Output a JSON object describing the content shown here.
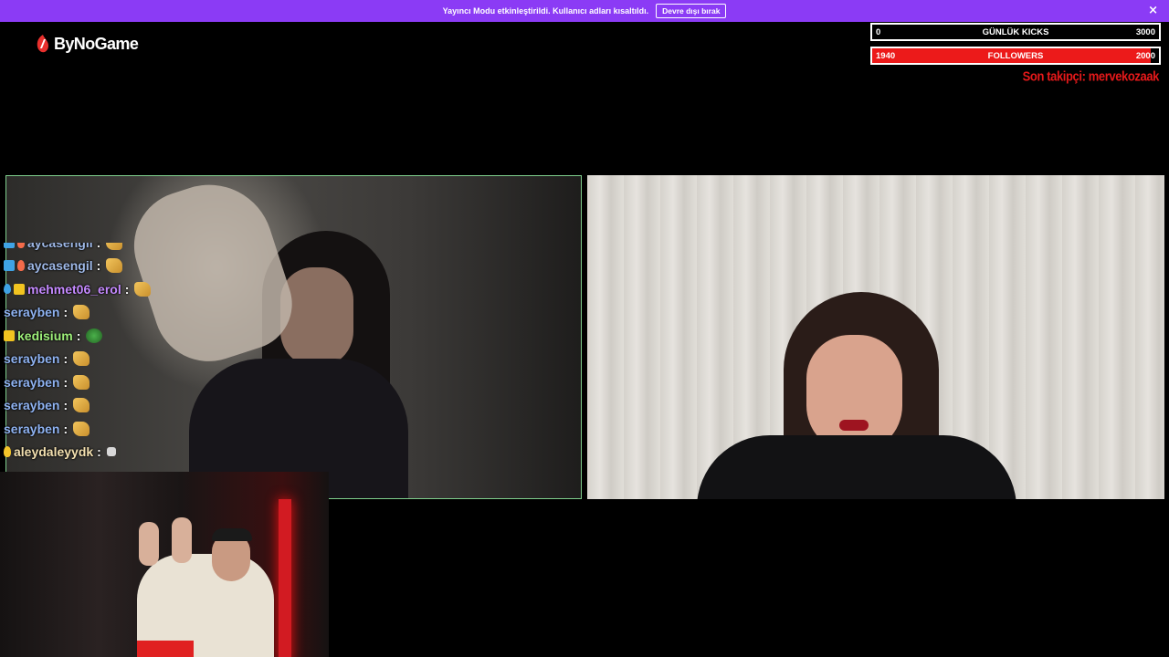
{
  "banner": {
    "text": "Yayıncı Modu etkinleştirildi. Kullanıcı adları kısaltıldı.",
    "button_label": "Devre dışı bırak",
    "close_glyph": "×"
  },
  "logo": {
    "text": "ByNoGame",
    "icon": "bynogame-logo-icon"
  },
  "goals": {
    "kicks": {
      "current": "0",
      "label": "GÜNLÜK KICKS",
      "target": "3000",
      "progress": 0
    },
    "followers": {
      "current": "1940",
      "label": "FOLLOWERS",
      "target": "2000",
      "progress": 0.97
    },
    "last_follower": "Son takipçi: mervekozaak",
    "accent_color": "#e5191a"
  },
  "chat": {
    "messages": [
      {
        "badges": [
          "blue",
          "fire"
        ],
        "user": "aycasengil",
        "user_color": "#9fb9e8",
        "emote": "clap"
      },
      {
        "badges": [
          "blue",
          "fire"
        ],
        "user": "aycasengil",
        "user_color": "#9fb9e8",
        "emote": "clap"
      },
      {
        "badges": [
          "drop",
          "crown"
        ],
        "user": "mehmet06_erol",
        "user_color": "#c58aff",
        "emote": "clap"
      },
      {
        "badges": [],
        "user": "serayben",
        "user_color": "#8fb3f2",
        "emote": "clap"
      },
      {
        "badges": [
          "crown"
        ],
        "user": "kedisium",
        "user_color": "#9ef07a",
        "emote": "frog"
      },
      {
        "badges": [],
        "user": "serayben",
        "user_color": "#8fb3f2",
        "emote": "clap"
      },
      {
        "badges": [],
        "user": "serayben",
        "user_color": "#8fb3f2",
        "emote": "clap"
      },
      {
        "badges": [],
        "user": "serayben",
        "user_color": "#8fb3f2",
        "emote": "clap"
      },
      {
        "badges": [],
        "user": "serayben",
        "user_color": "#8fb3f2",
        "emote": "clap"
      },
      {
        "badges": [
          "fire-yellow"
        ],
        "user": "aleydaleyydk",
        "user_color": "#f3e0b0",
        "emote": "small"
      }
    ],
    "separator": ":"
  },
  "colors": {
    "banner": "#8b3bf5",
    "video_border": "#7fcf8d"
  }
}
